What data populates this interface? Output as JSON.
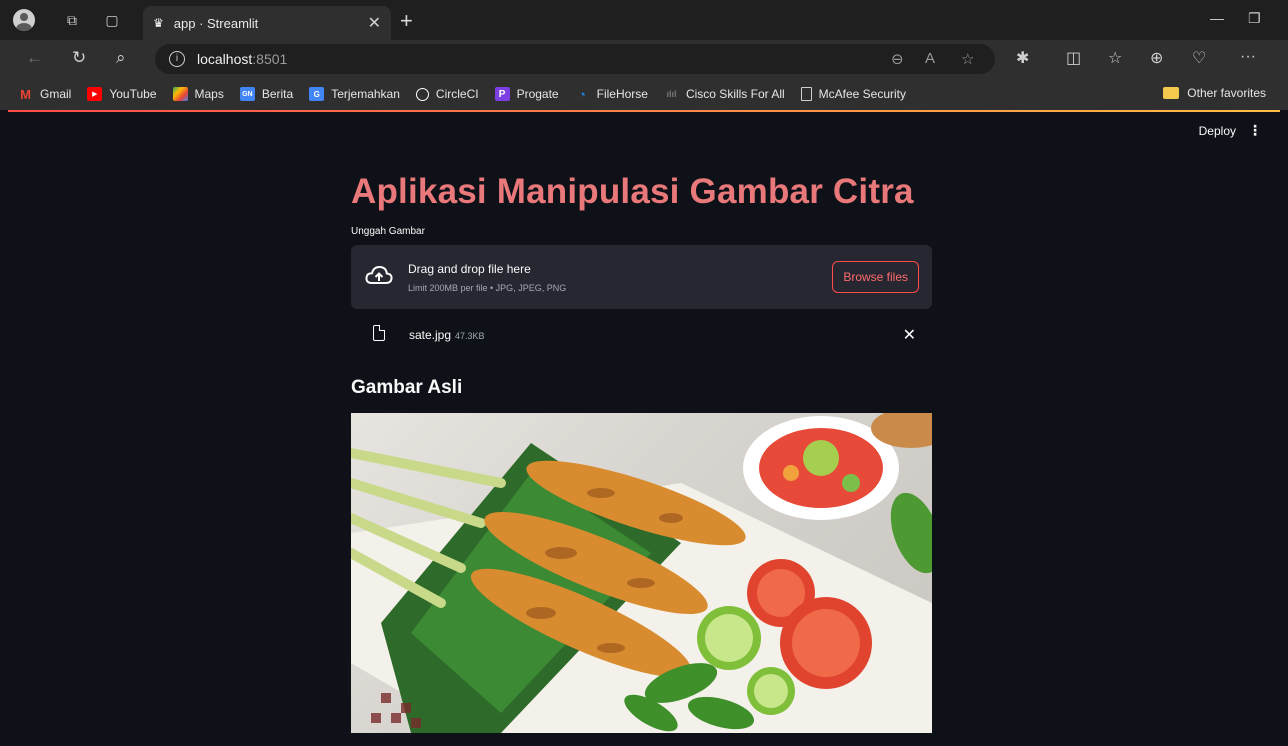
{
  "browser": {
    "tab_title": "app · Streamlit",
    "url_host": "localhost",
    "url_port": ":8501",
    "bookmarks": [
      {
        "label": "Gmail",
        "icon": "gmail-icon",
        "color": "#ea4335"
      },
      {
        "label": "YouTube",
        "icon": "youtube-icon",
        "color": "#ff0000"
      },
      {
        "label": "Maps",
        "icon": "maps-icon",
        "color": "#34a853"
      },
      {
        "label": "Berita",
        "icon": "news-icon",
        "color": "#4285f4"
      },
      {
        "label": "Terjemahkan",
        "icon": "translate-icon",
        "color": "#4285f4"
      },
      {
        "label": "CircleCI",
        "icon": "circleci-icon",
        "color": "#ffffff"
      },
      {
        "label": "Progate",
        "icon": "progate-icon",
        "color": "#7b3fe4"
      },
      {
        "label": "FileHorse",
        "icon": "filehorse-icon",
        "color": "#1e88e5"
      },
      {
        "label": "Cisco Skills For All",
        "icon": "cisco-icon",
        "color": "#777777"
      },
      {
        "label": "McAfee Security",
        "icon": "page-icon",
        "color": "#cfcfcf"
      }
    ],
    "other_favorites": "Other favorites"
  },
  "app": {
    "deploy_label": "Deploy",
    "title": "Aplikasi Manipulasi Gambar Citra",
    "uploader_label": "Unggah Gambar",
    "dropzone_title": "Drag and drop file here",
    "dropzone_sub": "Limit 200MB per file • JPG, JPEG, PNG",
    "browse_label": "Browse files",
    "file_name": "sate.jpg",
    "file_size": "47.3KB",
    "subheader": "Gambar Asli",
    "accent_color": "#ff4b4b",
    "title_color": "#e9787a"
  }
}
